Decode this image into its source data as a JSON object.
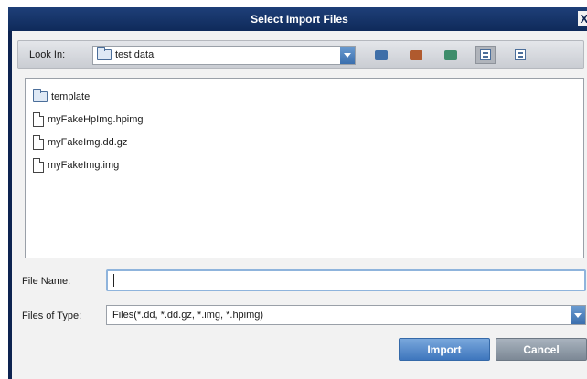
{
  "dialog": {
    "title": "Select Import Files",
    "close_glyph": "X"
  },
  "toolbar": {
    "look_in_label": "Look In:",
    "look_in_value": "test data",
    "buttons": [
      {
        "icon": "up-one-level-icon",
        "color": "#3f6fa8"
      },
      {
        "icon": "home-icon",
        "color": "#b05a2e"
      },
      {
        "icon": "new-folder-icon",
        "color": "#3e8d6b"
      },
      {
        "icon": "list-view-icon",
        "pressed": true
      },
      {
        "icon": "details-view-icon",
        "pressed": false
      }
    ]
  },
  "files": [
    {
      "name": "template",
      "type": "folder"
    },
    {
      "name": "myFakeHpImg.hpimg",
      "type": "file"
    },
    {
      "name": "myFakeImg.dd.gz",
      "type": "file"
    },
    {
      "name": "myFakeImg.img",
      "type": "file"
    }
  ],
  "form": {
    "file_name_label": "File Name:",
    "file_name_value": "",
    "file_type_label": "Files of Type:",
    "file_type_value": "Files(*.dd, *.dd.gz, *.img, *.hpimg)"
  },
  "actions": {
    "import_label": "Import",
    "cancel_label": "Cancel"
  },
  "colors": {
    "title_bar": "#0f2a5a",
    "primary_button": "#3e76bd",
    "secondary_button": "#7c8895"
  }
}
